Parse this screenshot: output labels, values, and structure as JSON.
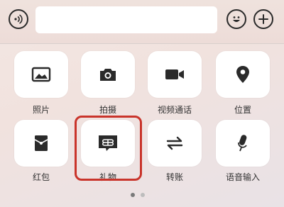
{
  "input_bar": {
    "voice_icon": "voice-icon",
    "emoji_icon": "emoji-icon",
    "plus_icon": "plus-icon",
    "text_value": ""
  },
  "actions": [
    {
      "label": "照片",
      "icon": "photo-icon"
    },
    {
      "label": "拍摄",
      "icon": "camera-icon"
    },
    {
      "label": "视频通话",
      "icon": "video-call-icon"
    },
    {
      "label": "位置",
      "icon": "location-icon"
    },
    {
      "label": "红包",
      "icon": "red-packet-icon"
    },
    {
      "label": "礼物",
      "icon": "gift-icon"
    },
    {
      "label": "转账",
      "icon": "transfer-icon"
    },
    {
      "label": "语音输入",
      "icon": "microphone-icon"
    }
  ],
  "highlight_color": "#c9342b",
  "pager": {
    "current_page": 1,
    "total_pages": 2
  }
}
